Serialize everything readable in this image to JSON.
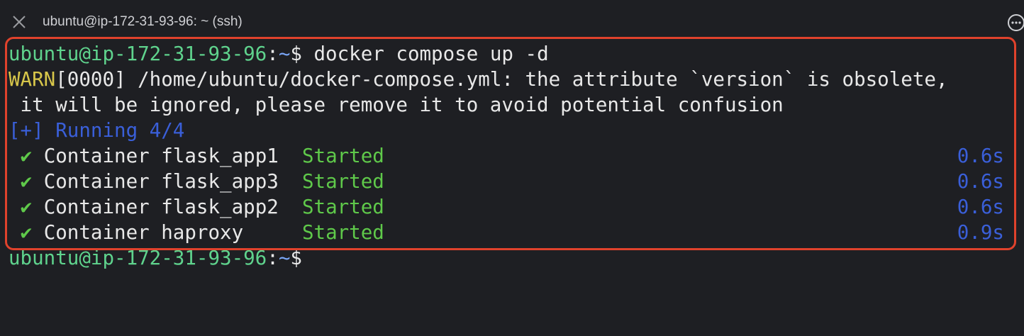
{
  "window": {
    "tab_title": "ubuntu@ip-172-31-93-96: ~ (ssh)"
  },
  "terminal": {
    "prompt_user": "ubuntu@ip-172-31-93-96",
    "prompt_sep": ":",
    "prompt_path": "~",
    "prompt_symbol": "$",
    "command": " docker compose up -d",
    "warn_prefix": "WARN",
    "warn_line1": "[0000] /home/ubuntu/docker-compose.yml: the attribute `version` is obsolete,",
    "warn_line2": " it will be ignored, please remove it to avoid potential confusion",
    "running": "[+] Running 4/4",
    "containers": [
      {
        "check": "✔",
        "name": "Container flask_app1",
        "status": "Started",
        "time": "0.6s"
      },
      {
        "check": "✔",
        "name": "Container flask_app3",
        "status": "Started",
        "time": "0.6s"
      },
      {
        "check": "✔",
        "name": "Container flask_app2",
        "status": "Started",
        "time": "0.6s"
      },
      {
        "check": "✔",
        "name": "Container haproxy   ",
        "status": "Started",
        "time": "0.9s"
      }
    ]
  },
  "colors": {
    "background": "#1e1f23",
    "prompt_green": "#5fd38d",
    "highlight_red": "#e0422c",
    "blue": "#3a5fd9",
    "warn_yellow": "#d7c64a"
  }
}
